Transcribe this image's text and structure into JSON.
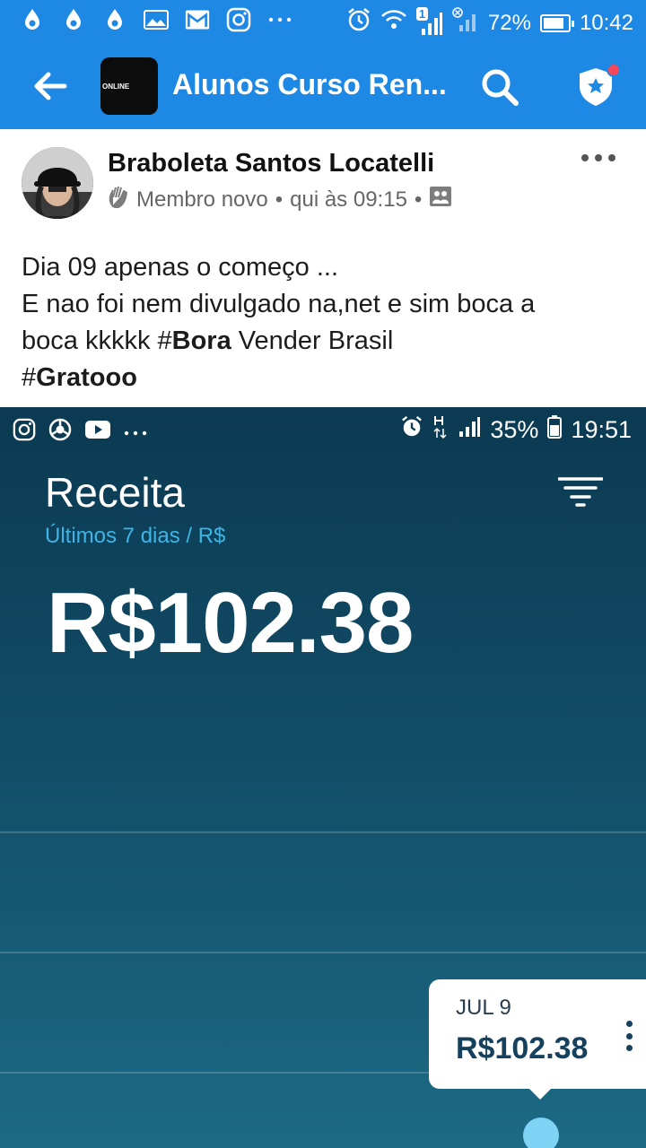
{
  "status_bar": {
    "battery": "72%",
    "time": "10:42",
    "notification_badge": "1"
  },
  "app_bar": {
    "title": "Alunos Curso Ren...",
    "group_thumb_text": "ONLINE"
  },
  "post": {
    "author": "Braboleta Santos Locatelli",
    "badge": "Membro novo",
    "timestamp": "qui às 09:15",
    "separator": "•",
    "text_line1": "Dia 09 apenas o começo ...",
    "text_line2": "E nao foi nem divulgado na,net e sim boca a",
    "text_line3_a": "boca kkkkk #",
    "text_line3_b": "Bora",
    "text_line3_c": " Vender Brasil",
    "text_line4_a": "#",
    "text_line4_b": "Gratooo"
  },
  "embedded": {
    "status": {
      "battery": "35%",
      "time": "19:51"
    },
    "title": "Receita",
    "subtitle": "Últimos 7 dias / R$",
    "total": "R$102.38",
    "tooltip": {
      "date": "JUL 9",
      "value": "R$102.38"
    }
  },
  "colors": {
    "app_blue": "#1e88e5",
    "shot_dark": "#0b3a52",
    "accent_cyan": "#3fb4e6"
  }
}
